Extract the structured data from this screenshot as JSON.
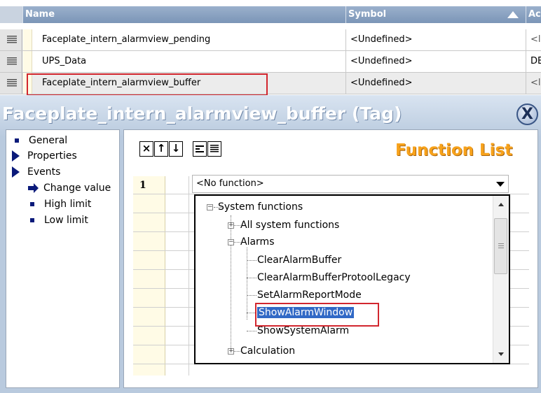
{
  "table": {
    "columns": [
      "Name",
      "Symbol",
      "Ac"
    ],
    "rows": [
      {
        "name": "Faceplate_intern_alarmview_pending",
        "symbol": "<Undefined>",
        "extra": "<l"
      },
      {
        "name": "UPS_Data",
        "symbol": "<Undefined>",
        "extra": "DE"
      },
      {
        "name": "Faceplate_intern_alarmview_buffer",
        "symbol": "<Undefined>",
        "extra": "<l"
      }
    ]
  },
  "pane": {
    "title": "Faceplate_intern_alarmview_buffer (Tag)",
    "close_glyph": "X"
  },
  "nav": {
    "items": [
      {
        "label": "General"
      },
      {
        "label": "Properties"
      },
      {
        "label": "Events"
      },
      {
        "label": "Change value"
      },
      {
        "label": "High limit"
      },
      {
        "label": "Low limit"
      }
    ]
  },
  "toolbar": {
    "delete_glyph": "×",
    "up_glyph": "↑",
    "down_glyph": "↓"
  },
  "function_list": {
    "title": "Function List",
    "row_number": "1",
    "selected_value": "<No function>"
  },
  "tree": {
    "system_functions": "System functions",
    "all_system_functions": "All system functions",
    "alarms": "Alarms",
    "items": [
      "ClearAlarmBuffer",
      "ClearAlarmBufferProtoolLegacy",
      "SetAlarmReportMode",
      "ShowAlarmWindow",
      "ShowSystemAlarm"
    ],
    "calculation": "Calculation",
    "selected": "ShowAlarmWindow"
  },
  "colors": {
    "header_bg": "#8aa3c4",
    "title_orange": "#f7a21b",
    "highlight_red": "#d2262e",
    "selection_blue": "#3169c6"
  }
}
